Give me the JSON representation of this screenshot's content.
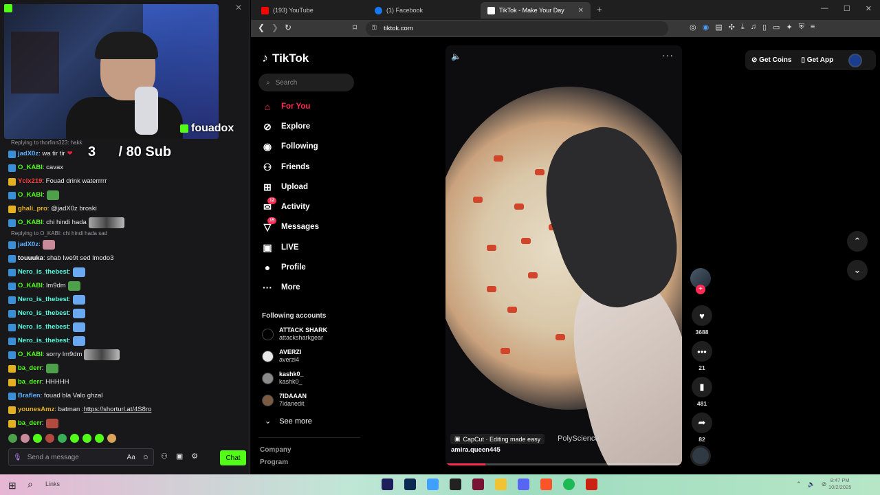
{
  "stream": {
    "streamer_name": "fouadox",
    "sub_goal": "3      / 80 Sub",
    "chat": [
      {
        "type": "reply",
        "text": "Replying to thorfinn323: hakk"
      },
      {
        "user": "jadX0z",
        "color": "#5ab0ff",
        "badge": "blue",
        "text": ": wa tir tir",
        "emote": "heart"
      },
      {
        "user": "O_KABI",
        "color": "#53fc18",
        "badge": "blue",
        "text": ": cavax"
      },
      {
        "user": "Ycix219",
        "color": "#ff3b3b",
        "badge": "gold",
        "text": ": Fouad drink waterrrrr"
      },
      {
        "user": "O_KABI",
        "color": "#53fc18",
        "badge": "blue",
        "text": ":",
        "emote": "frog"
      },
      {
        "user": "ghali_pro",
        "color": "#e3b022",
        "badge": "gold",
        "text": ": @jadX0z broski"
      },
      {
        "user": "O_KABI",
        "color": "#53fc18",
        "badge": "blue",
        "text": ": chi hindi hada",
        "emote": "pic"
      },
      {
        "type": "reply",
        "text": "Replying to O_KABI: chi hindi hada sad"
      },
      {
        "user": "jadX0z",
        "color": "#5ab0ff",
        "badge": "blue",
        "text": ":",
        "emote": "pink"
      },
      {
        "user": "touuuka",
        "color": "#ffffff",
        "badge": "blue",
        "text": ": shab lwe9t sed lmodo3"
      },
      {
        "user": "Nero_is_thebest",
        "color": "#53fce0",
        "badge": "blue",
        "text": ":",
        "emote": "wing"
      },
      {
        "user": "O_KABI",
        "color": "#53fc18",
        "badge": "blue",
        "text": ": lm9dm",
        "emote": "frog"
      },
      {
        "user": "Nero_is_thebest",
        "color": "#53fce0",
        "badge": "blue",
        "text": ":",
        "emote": "wing"
      },
      {
        "user": "Nero_is_thebest",
        "color": "#53fce0",
        "badge": "blue",
        "text": ":",
        "emote": "wing"
      },
      {
        "user": "Nero_is_thebest",
        "color": "#53fce0",
        "badge": "blue",
        "text": ":",
        "emote": "wing"
      },
      {
        "user": "Nero_is_thebest",
        "color": "#53fce0",
        "badge": "blue",
        "text": ":",
        "emote": "wing"
      },
      {
        "user": "O_KABI",
        "color": "#53fc18",
        "badge": "blue",
        "text": ": sorry lm9dm",
        "emote": "pic"
      },
      {
        "user": "ba_derr",
        "color": "#53fc18",
        "badge": "gold",
        "text": ":",
        "emote": "frog"
      },
      {
        "user": "ba_derr",
        "color": "#53fc18",
        "badge": "gold",
        "text": ": HHHHH"
      },
      {
        "user": "Braflen",
        "color": "#5ab0ff",
        "badge": "blue",
        "text": ": fouad bla Valo ghzal"
      },
      {
        "user": "younesAmz",
        "color": "#e3b022",
        "badge": "gold",
        "text": ": batman : ",
        "link": "https://shorturl.at/4S8ro"
      },
      {
        "user": "ba_derr",
        "color": "#53fc18",
        "badge": "gold",
        "text": ":",
        "emote": "red"
      }
    ],
    "chat_placeholder": "Send a message",
    "chat_button": "Chat"
  },
  "browser": {
    "tabs": [
      {
        "label": "(193) YouTube",
        "favicon_color": "#ff0000"
      },
      {
        "label": "(1) Facebook",
        "favicon_color": "#1877f2"
      },
      {
        "label": "TikTok - Make Your Day",
        "favicon_color": "#000000",
        "active": true
      }
    ],
    "url": "tiktok.com"
  },
  "tiktok": {
    "logo": "TikTok",
    "search_placeholder": "Search",
    "nav": [
      {
        "label": "For You",
        "icon": "home-icon",
        "active": true
      },
      {
        "label": "Explore",
        "icon": "compass-icon"
      },
      {
        "label": "Following",
        "icon": "following-icon"
      },
      {
        "label": "Friends",
        "icon": "friends-icon"
      },
      {
        "label": "Upload",
        "icon": "upload-icon"
      },
      {
        "label": "Activity",
        "icon": "activity-icon",
        "count": "12"
      },
      {
        "label": "Messages",
        "icon": "messages-icon",
        "count": "15"
      },
      {
        "label": "LIVE",
        "icon": "live-icon"
      },
      {
        "label": "Profile",
        "icon": "profile-icon"
      },
      {
        "label": "More",
        "icon": "more-icon"
      }
    ],
    "following_accounts_title": "Following accounts",
    "following_accounts": [
      {
        "name": "ATTACK SHARK",
        "handle": "attacksharkgear",
        "avatar_color": "#000000"
      },
      {
        "name": "AVERZI",
        "handle": "averzi4",
        "avatar_color": "#e8e8e8"
      },
      {
        "name": "kashk0_",
        "handle": "kashk0_",
        "avatar_color": "#8a8a8a"
      },
      {
        "name": "7IDAAAN",
        "handle": "7idanedit",
        "avatar_color": "#7a5a40"
      }
    ],
    "see_more": "See more",
    "footer": [
      "Company",
      "Program"
    ],
    "video": {
      "capcut": "CapCut · Editing made easy",
      "overlay_text": "PolyScience",
      "author": "amira.queen445",
      "progress": 0.17
    },
    "actions": {
      "likes": "3688",
      "comments": "21",
      "saves": "481",
      "shares": "82"
    },
    "get_coins": "Get Coins",
    "get_app": "Get App"
  },
  "taskbar": {
    "links_label": "Links",
    "clock_time": "8:47 PM",
    "clock_date": "10/2/2025"
  }
}
